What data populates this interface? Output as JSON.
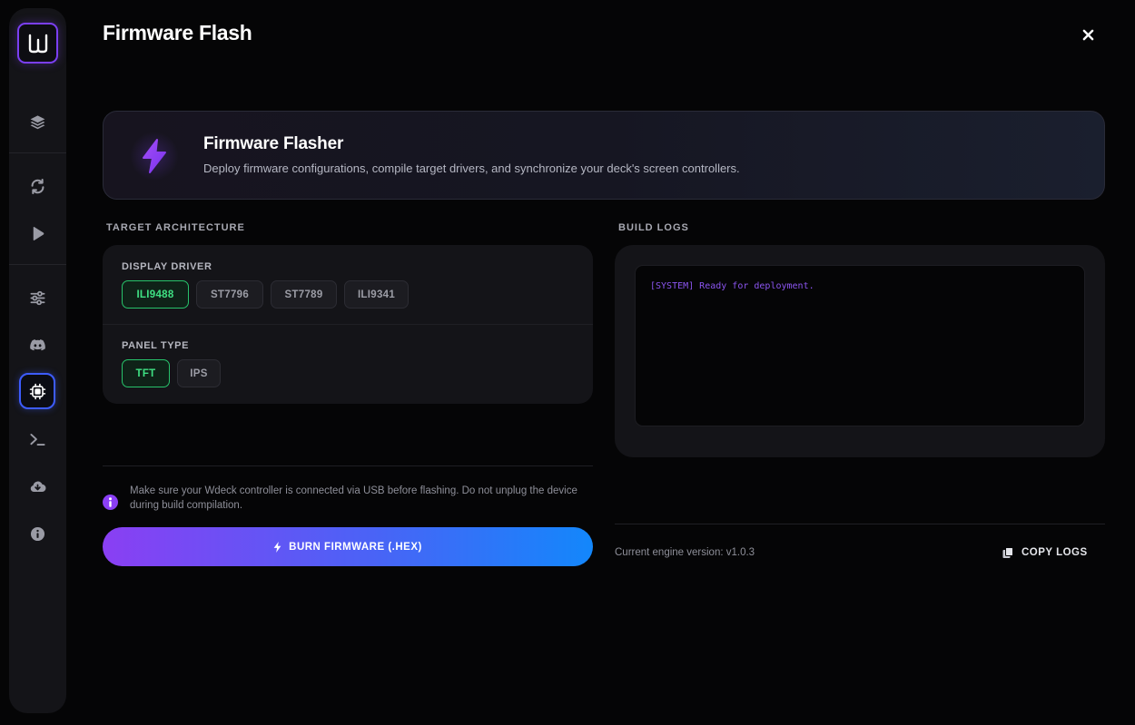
{
  "page": {
    "title": "Firmware Flash"
  },
  "sidebar": {
    "logo_letter": "W",
    "items": [
      {
        "name": "layers",
        "icon": "layers-icon"
      },
      {
        "name": "sync",
        "icon": "sync-icon"
      },
      {
        "name": "play",
        "icon": "play-icon"
      },
      {
        "name": "settings",
        "icon": "sliders-icon"
      },
      {
        "name": "discord",
        "icon": "discord-icon"
      },
      {
        "name": "firmware",
        "icon": "chip-icon",
        "active": true
      },
      {
        "name": "terminal",
        "icon": "terminal-icon"
      },
      {
        "name": "download",
        "icon": "cloud-download-icon"
      },
      {
        "name": "info",
        "icon": "info-icon"
      }
    ]
  },
  "hero": {
    "title": "Firmware Flasher",
    "subtitle": "Deploy firmware configurations, compile target drivers, and synchronize your deck's screen controllers."
  },
  "target": {
    "section_label": "TARGET ARCHITECTURE",
    "driver_label": "DISPLAY DRIVER",
    "drivers": [
      "ILI9488",
      "ST7796",
      "ST7789",
      "ILI9341"
    ],
    "selected_driver": "ILI9488",
    "panel_label": "PANEL TYPE",
    "panels": [
      "TFT",
      "IPS"
    ],
    "selected_panel": "TFT"
  },
  "notice": "Make sure your Wdeck controller is connected via USB before flashing. Do not unplug the device during build compilation.",
  "burn_label": "BURN FIRMWARE (.HEX)",
  "logs": {
    "section_label": "BUILD LOGS",
    "lines": [
      "[SYSTEM] Ready for deployment."
    ],
    "version": "Current engine version: v1.0.3",
    "copy_label": "COPY LOGS"
  },
  "colors": {
    "accent_purple": "#8a3ff3",
    "accent_blue": "#1387fb",
    "selected_green": "#3fe083",
    "background": "#050506"
  }
}
